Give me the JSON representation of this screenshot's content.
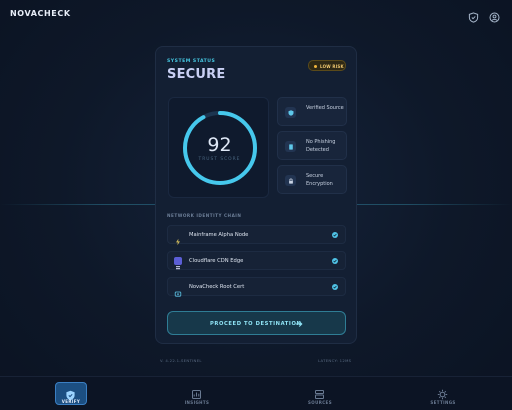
{
  "app": {
    "brand": "NOVACHECK"
  },
  "status": {
    "eyebrow": "SYSTEM STATUS",
    "value": "SECURE",
    "risk_badge": "LOW RISK"
  },
  "trust": {
    "score": "92",
    "label": "TRUST SCORE",
    "fraction": 0.92
  },
  "features": [
    {
      "label": "Verified Source",
      "icon": "shield-check-icon"
    },
    {
      "label": "No Phishing Detected",
      "icon": "document-icon"
    },
    {
      "label": "Secure Encryption",
      "icon": "lock-icon"
    }
  ],
  "chain": {
    "title": "NETWORK IDENTITY CHAIN",
    "items": [
      {
        "label": "Mainframe Alpha Node",
        "icon": "node-icon"
      },
      {
        "label": "Cloudflare CDN Edge",
        "icon": "cdn-icon"
      },
      {
        "label": "NovaCheck Root Cert",
        "icon": "cert-icon"
      }
    ]
  },
  "action": {
    "proceed_label": "PROCEED TO DESTINATION"
  },
  "footer": {
    "version": "V. 4.22.1-SENTINEL",
    "latency": "LATENCY: 12MS"
  },
  "nav": [
    {
      "label": "VERIFY",
      "icon": "shield-icon",
      "active": true
    },
    {
      "label": "INSIGHTS",
      "icon": "insights-icon",
      "active": false
    },
    {
      "label": "SOURCES",
      "icon": "sources-icon",
      "active": false
    },
    {
      "label": "SETTINGS",
      "icon": "gear-icon",
      "active": false
    }
  ],
  "colors": {
    "accent": "#45c6e0",
    "warning": "#f0b43c",
    "active_nav": "#1c4f82"
  }
}
